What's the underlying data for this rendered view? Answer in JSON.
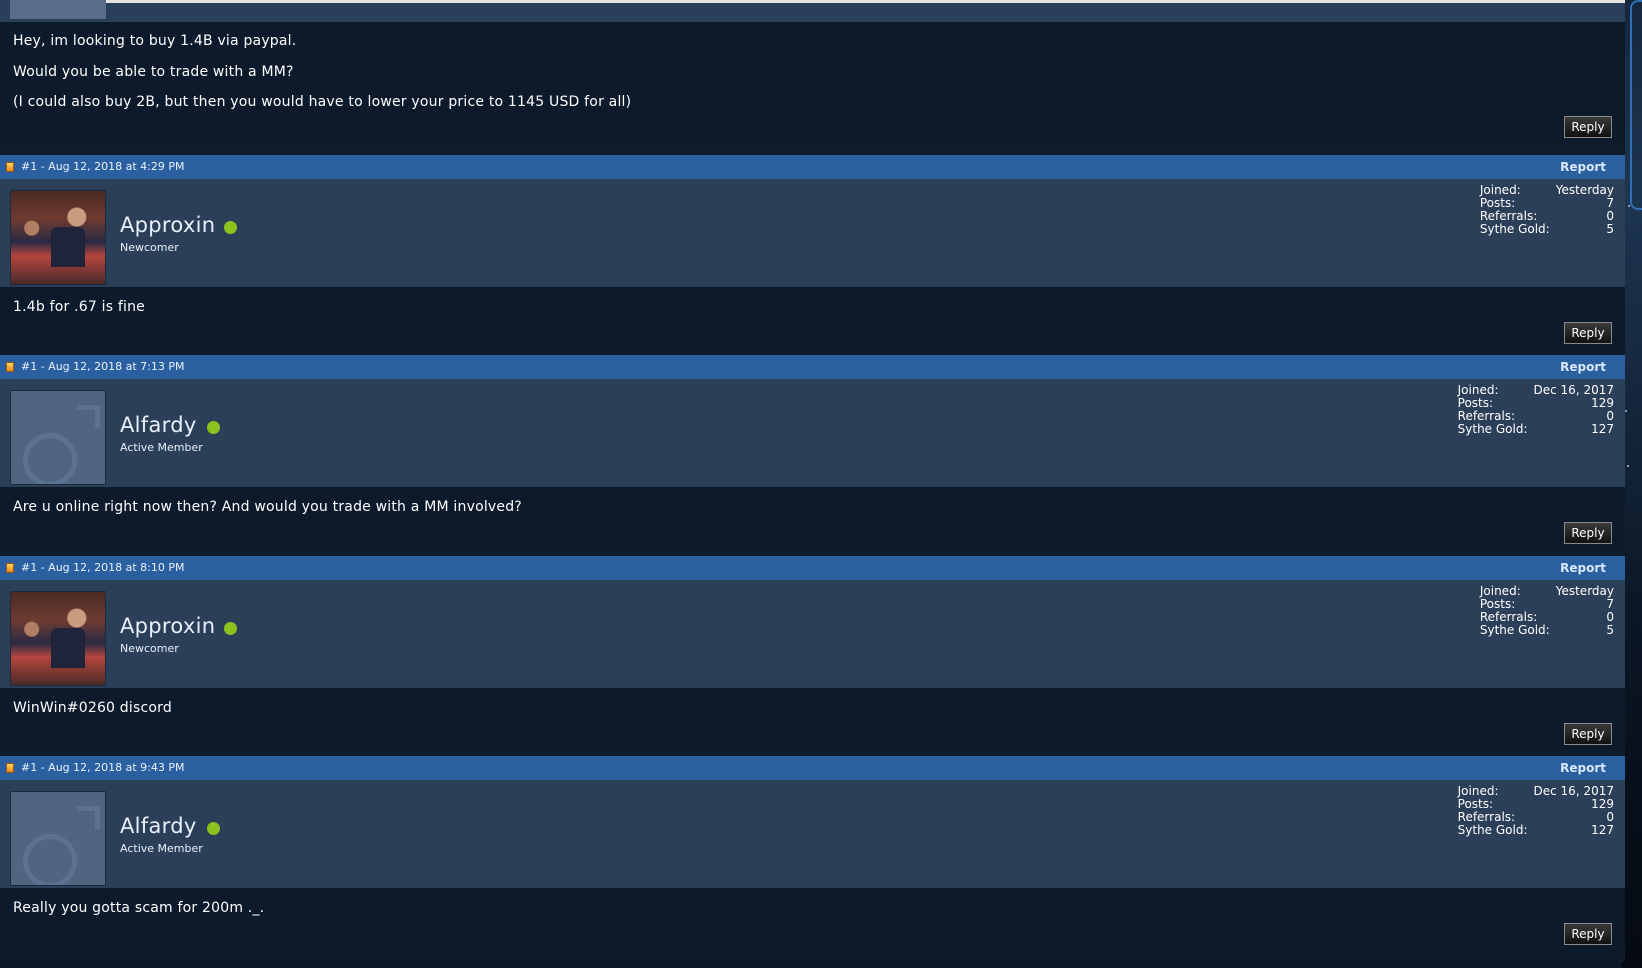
{
  "first_post": {
    "lines": [
      "Hey, im looking to buy 1.4B via paypal.",
      "Would you be able to trade with a MM?",
      "(I could also buy 2B, but then you would have to lower your price to 1145 USD for all)"
    ],
    "reply_label": "Reply"
  },
  "posts": [
    {
      "meta": "#1 - Aug 12, 2018 at 4:29 PM",
      "report_label": "Report",
      "username": "Approxin",
      "rank": "Newcomer",
      "avatar_icon": "user-photo",
      "stats": {
        "joined_label": "Joined:",
        "joined": "Yesterday",
        "posts_label": "Posts:",
        "posts": "7",
        "referrals_label": "Referrals:",
        "referrals": "0",
        "gold_label": "Sythe Gold:",
        "gold": "5"
      },
      "message": "1.4b for .67 is fine",
      "reply_label": "Reply"
    },
    {
      "meta": "#1 - Aug 12, 2018 at 7:13 PM",
      "report_label": "Report",
      "username": "Alfardy",
      "rank": "Active Member",
      "avatar_icon": "male-symbol-icon",
      "stats": {
        "joined_label": "Joined:",
        "joined": "Dec 16, 2017",
        "posts_label": "Posts:",
        "posts": "129",
        "referrals_label": "Referrals:",
        "referrals": "0",
        "gold_label": "Sythe Gold:",
        "gold": "127"
      },
      "message": "Are u online right now then? And would you trade with a MM involved?",
      "reply_label": "Reply"
    },
    {
      "meta": "#1 - Aug 12, 2018 at 8:10 PM",
      "report_label": "Report",
      "username": "Approxin",
      "rank": "Newcomer",
      "avatar_icon": "user-photo",
      "stats": {
        "joined_label": "Joined:",
        "joined": "Yesterday",
        "posts_label": "Posts:",
        "posts": "7",
        "referrals_label": "Referrals:",
        "referrals": "0",
        "gold_label": "Sythe Gold:",
        "gold": "5"
      },
      "message": "WinWin#0260 discord",
      "reply_label": "Reply"
    },
    {
      "meta": "#1 - Aug 12, 2018 at 9:43 PM",
      "report_label": "Report",
      "username": "Alfardy",
      "rank": "Active Member",
      "avatar_icon": "male-symbol-icon",
      "stats": {
        "joined_label": "Joined:",
        "joined": "Dec 16, 2017",
        "posts_label": "Posts:",
        "posts": "129",
        "referrals_label": "Referrals:",
        "referrals": "0",
        "gold_label": "Sythe Gold:",
        "gold": "127"
      },
      "message": "Really you gotta scam for 200m ._.",
      "reply_label": "Reply"
    }
  ],
  "colors": {
    "header_bar": "#2a5fa0",
    "user_row": "#2c3f59",
    "message_bg": "#0c1a2c",
    "online": "#8bc21e"
  }
}
